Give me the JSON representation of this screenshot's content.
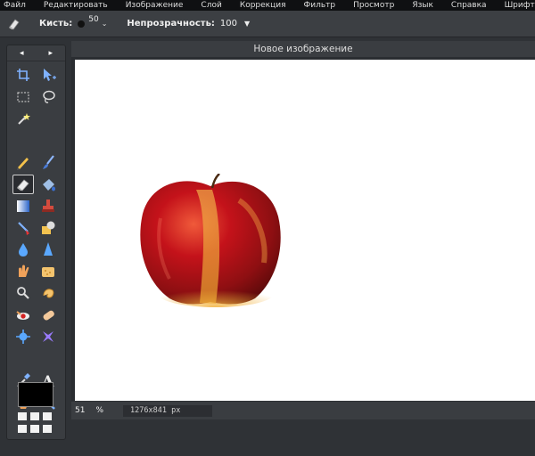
{
  "menu": [
    "Файл",
    "Редактировать",
    "Изображение",
    "Слой",
    "Коррекция",
    "Фильтр",
    "Просмотр",
    "Язык",
    "Справка",
    "Шрифт"
  ],
  "options": {
    "brush_label": "Кисть:",
    "brush_size": "50",
    "opacity_label": "Непрозрачность:",
    "opacity_value": "100"
  },
  "panel": {
    "nav_prev": "◂",
    "nav_next": "▸",
    "tools": [
      {
        "name": "crop-tool-icon"
      },
      {
        "name": "move-tool-icon"
      },
      {
        "name": "marquee-tool-icon"
      },
      {
        "name": "lasso-tool-icon"
      },
      {
        "name": "magic-wand-tool-icon"
      },
      {
        "name": "empty-slot"
      },
      {
        "name": "pencil-tool-icon"
      },
      {
        "name": "brush-tool-icon"
      },
      {
        "name": "eraser-tool-icon"
      },
      {
        "name": "fill-tool-icon"
      },
      {
        "name": "gradient-tool-icon"
      },
      {
        "name": "clone-stamp-tool-icon"
      },
      {
        "name": "color-replace-tool-icon"
      },
      {
        "name": "drawing-tool-icon"
      },
      {
        "name": "blur-tool-icon"
      },
      {
        "name": "sharpen-tool-icon"
      },
      {
        "name": "smudge-tool-icon"
      },
      {
        "name": "sponge-tool-icon"
      },
      {
        "name": "dodge-tool-icon"
      },
      {
        "name": "burn-tool-icon"
      },
      {
        "name": "red-eye-tool-icon"
      },
      {
        "name": "spot-heal-tool-icon"
      },
      {
        "name": "bloat-tool-icon"
      },
      {
        "name": "pinch-tool-icon"
      },
      {
        "name": "color-picker-tool-icon"
      },
      {
        "name": "type-tool-icon"
      },
      {
        "name": "hand-tool-icon"
      },
      {
        "name": "zoom-tool-icon"
      }
    ],
    "active_tool": "eraser-tool-icon",
    "foreground_color": "#000000"
  },
  "document": {
    "title": "Новое изображение"
  },
  "status": {
    "zoom": "51",
    "zoom_unit": "%",
    "size": "1276x841 px"
  }
}
